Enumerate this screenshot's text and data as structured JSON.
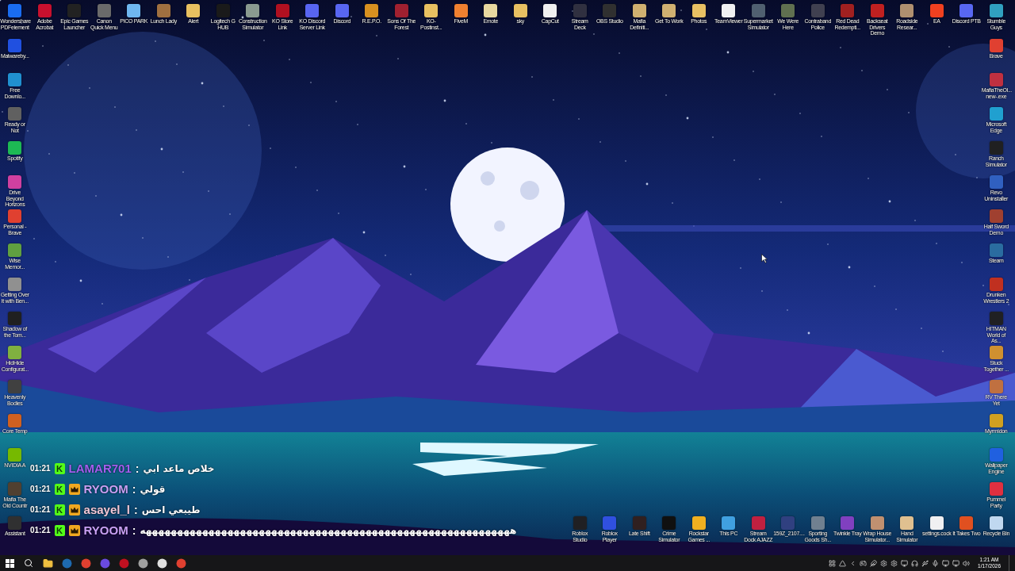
{
  "desktop": {
    "top_row": [
      {
        "label": "Wondershare PDFelement",
        "color": "#1a6cf0"
      },
      {
        "label": "Adobe Acrobat",
        "color": "#c8102e"
      },
      {
        "label": "Epic Games Launcher",
        "color": "#222222"
      },
      {
        "label": "Canon Quick Menu",
        "color": "#6a6a6a"
      },
      {
        "label": "PICO PARK",
        "color": "#6fb7f0"
      },
      {
        "label": "Lunch Lady",
        "color": "#a07040"
      },
      {
        "label": "Alert",
        "color": "#e8c060"
      },
      {
        "label": "Logitech G HUB",
        "color": "#1a1a1a"
      },
      {
        "label": "Construction Simulator",
        "color": "#8a9a90"
      },
      {
        "label": "KO Store Link",
        "color": "#b01020"
      },
      {
        "label": "KO Discord Server Link",
        "color": "#5865f2"
      },
      {
        "label": "Discord",
        "color": "#5866f2"
      },
      {
        "label": "R.E.P.O.",
        "color": "#d89020"
      },
      {
        "label": "Sons Of The Forest",
        "color": "#a02030"
      },
      {
        "label": "KO-Postinst...",
        "color": "#e8c061"
      },
      {
        "label": "FiveM",
        "color": "#f08030"
      },
      {
        "label": "Emote",
        "color": "#e8d8a0"
      },
      {
        "label": "sky",
        "color": "#e8c062"
      },
      {
        "label": "CapCut",
        "color": "#f0f0f0"
      },
      {
        "label": "Stream Deck",
        "color": "#303040"
      },
      {
        "label": "OBS Studio",
        "color": "#303030"
      },
      {
        "label": "Mafia Definiti...",
        "color": "#d0b070"
      },
      {
        "label": "Get To Work",
        "color": "#d0b071"
      },
      {
        "label": "Photos",
        "color": "#e8c063"
      },
      {
        "label": "TeamViewer",
        "color": "#f0f0f1"
      },
      {
        "label": "Supermarket Simulator",
        "color": "#506070"
      },
      {
        "label": "We Were Here",
        "color": "#607050"
      },
      {
        "label": "Contraband Police",
        "color": "#404050"
      },
      {
        "label": "Red Dead Redempti...",
        "color": "#a02020"
      },
      {
        "label": "Backseat Drivers Demo",
        "color": "#c02020"
      },
      {
        "label": "Roadside Resear...",
        "color": "#b09070"
      },
      {
        "label": "EA",
        "color": "#f04020"
      },
      {
        "label": "Discord PTB",
        "color": "#5867f2"
      },
      {
        "label": "Stumble Guys",
        "color": "#30a0c0"
      }
    ],
    "left_column": [
      {
        "label": "Malwareby...",
        "color": "#2050e0"
      },
      {
        "label": "Free Downlo...",
        "color": "#2090d0"
      },
      {
        "label": "Ready or Not",
        "color": "#606060"
      },
      {
        "label": "Spotify",
        "color": "#1db954"
      },
      {
        "label": "Drive Beyond Horizons",
        "color": "#d040a0"
      },
      {
        "label": "Personal - Brave",
        "color": "#e04030"
      },
      {
        "label": "Wise Memor...",
        "color": "#60a040"
      },
      {
        "label": "Getting Over It with Ben...",
        "color": "#909090"
      },
      {
        "label": "Shadow of the Tom...",
        "color": "#202020"
      },
      {
        "label": "HidHide Configurat...",
        "color": "#80b040"
      },
      {
        "label": "Heavenly Bodies",
        "color": "#404040"
      },
      {
        "label": "Core Temp",
        "color": "#d06020"
      },
      {
        "label": "NVIDIA A",
        "color": "#76b900"
      },
      {
        "label": "Mafia The Old Countr",
        "color": "#504030"
      },
      {
        "label": "Assistant",
        "color": "#303031"
      }
    ],
    "right_column": [
      {
        "label": "Brave",
        "color": "#e04031"
      },
      {
        "label": "MafiaTheOl... new-.exe",
        "color": "#c03040"
      },
      {
        "label": "Microsoft Edge",
        "color": "#20a0d0"
      },
      {
        "label": "Ranch Simulator",
        "color": "#202021"
      },
      {
        "label": "Revo Uninstaller",
        "color": "#3060c0"
      },
      {
        "label": "Half Sword Demo",
        "color": "#a04030"
      },
      {
        "label": "Steam",
        "color": "#2a6ca0"
      },
      {
        "label": "Drunken Wrestlers 2",
        "color": "#c03020"
      },
      {
        "label": "HITMAN World of As...",
        "color": "#202022"
      },
      {
        "label": "Stuck Together ...",
        "color": "#d09030"
      },
      {
        "label": "RV There Yet",
        "color": "#c07040"
      },
      {
        "label": "Myrmidon",
        "color": "#d0a020"
      },
      {
        "label": "Wallpaper Engine",
        "color": "#2060e0"
      },
      {
        "label": "Pummel Party",
        "color": "#e03040"
      }
    ],
    "bottom_row": [
      {
        "label": "Roblox Studio",
        "color": "#202023"
      },
      {
        "label": "Roblox Player",
        "color": "#3050e0"
      },
      {
        "label": "Late Shift",
        "color": "#302020"
      },
      {
        "label": "Crime Simulator",
        "color": "#101010"
      },
      {
        "label": "Rockstar Games ...",
        "color": "#f0b020"
      },
      {
        "label": "This PC",
        "color": "#40a0e0"
      },
      {
        "label": "Stream Dock AJAZZ",
        "color": "#c02040"
      },
      {
        "label": "159Z_2107....",
        "color": "#304080"
      },
      {
        "label": "Sporting Goods Sh...",
        "color": "#708090"
      },
      {
        "label": "Twinkle Tray",
        "color": "#8040c0"
      },
      {
        "label": "Wrap House Simulator...",
        "color": "#c09070"
      },
      {
        "label": "Hand Simulator",
        "color": "#e0c090"
      },
      {
        "label": "settings.cock",
        "color": "#f0f0f2"
      },
      {
        "label": "It Takes Two",
        "color": "#e05020"
      },
      {
        "label": "Recycle Bin",
        "color": "#c0d8f0"
      }
    ]
  },
  "chat_overlay": {
    "messages": [
      {
        "time": "01:21",
        "badges": [
          {
            "kind": "letter",
            "label": "K"
          }
        ],
        "user": "LAMAR701",
        "color": "#a35ff0",
        "separator": ":",
        "text": "خلاص ماعد ابي"
      },
      {
        "time": "01:21",
        "badges": [
          {
            "kind": "letter",
            "label": "K"
          },
          {
            "kind": "crown"
          }
        ],
        "user": "RYOOM",
        "color": "#c9a0f5",
        "separator": ":",
        "text": "قولي"
      },
      {
        "time": "01:21",
        "badges": [
          {
            "kind": "letter",
            "label": "K"
          },
          {
            "kind": "crown"
          }
        ],
        "user": "asayel_l",
        "color": "#f2c8d8",
        "separator": ":",
        "text": "طيبعي احس"
      },
      {
        "time": "01:21",
        "badges": [
          {
            "kind": "letter",
            "label": "K"
          },
          {
            "kind": "crown"
          }
        ],
        "user": "RYOOM",
        "color": "#c9a0f5",
        "separator": ":",
        "text": "هههههههههههههههههههههههههههههههههههههههههههههههههههههههههههه"
      }
    ]
  },
  "taskbar": {
    "clock": {
      "time": "1:21 AM",
      "date": "1/17/2026"
    }
  }
}
